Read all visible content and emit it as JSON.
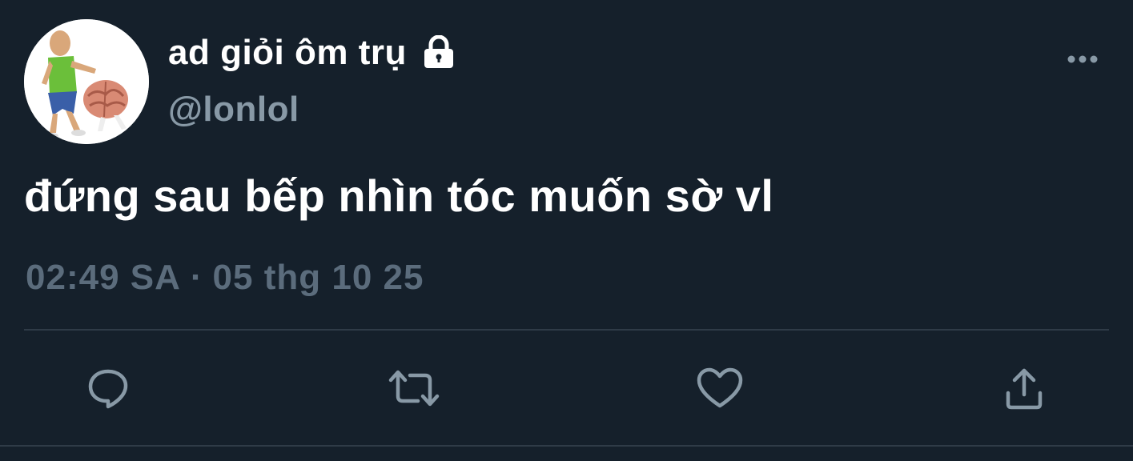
{
  "user": {
    "display_name": "ad giỏi ôm trụ",
    "handle": "@lonlol",
    "protected_icon": "lock-icon",
    "avatar_icon": "cartoon-man-pushing-brain"
  },
  "tweet": {
    "text": "đứng sau bếp nhìn tóc muốn sờ vl",
    "time": "02:49 SA",
    "separator": "·",
    "date": "05 thg 10 25"
  },
  "actions": {
    "more_icon": "more-horizontal-icon",
    "reply_icon": "reply-icon",
    "retweet_icon": "retweet-icon",
    "like_icon": "heart-icon",
    "share_icon": "share-icon"
  },
  "colors": {
    "background": "#15202b",
    "primary_text": "#ffffff",
    "secondary_text": "#8899a6",
    "timestamp_text": "#5b6c7c",
    "icon": "#8899a6",
    "divider": "#2f3b47"
  }
}
